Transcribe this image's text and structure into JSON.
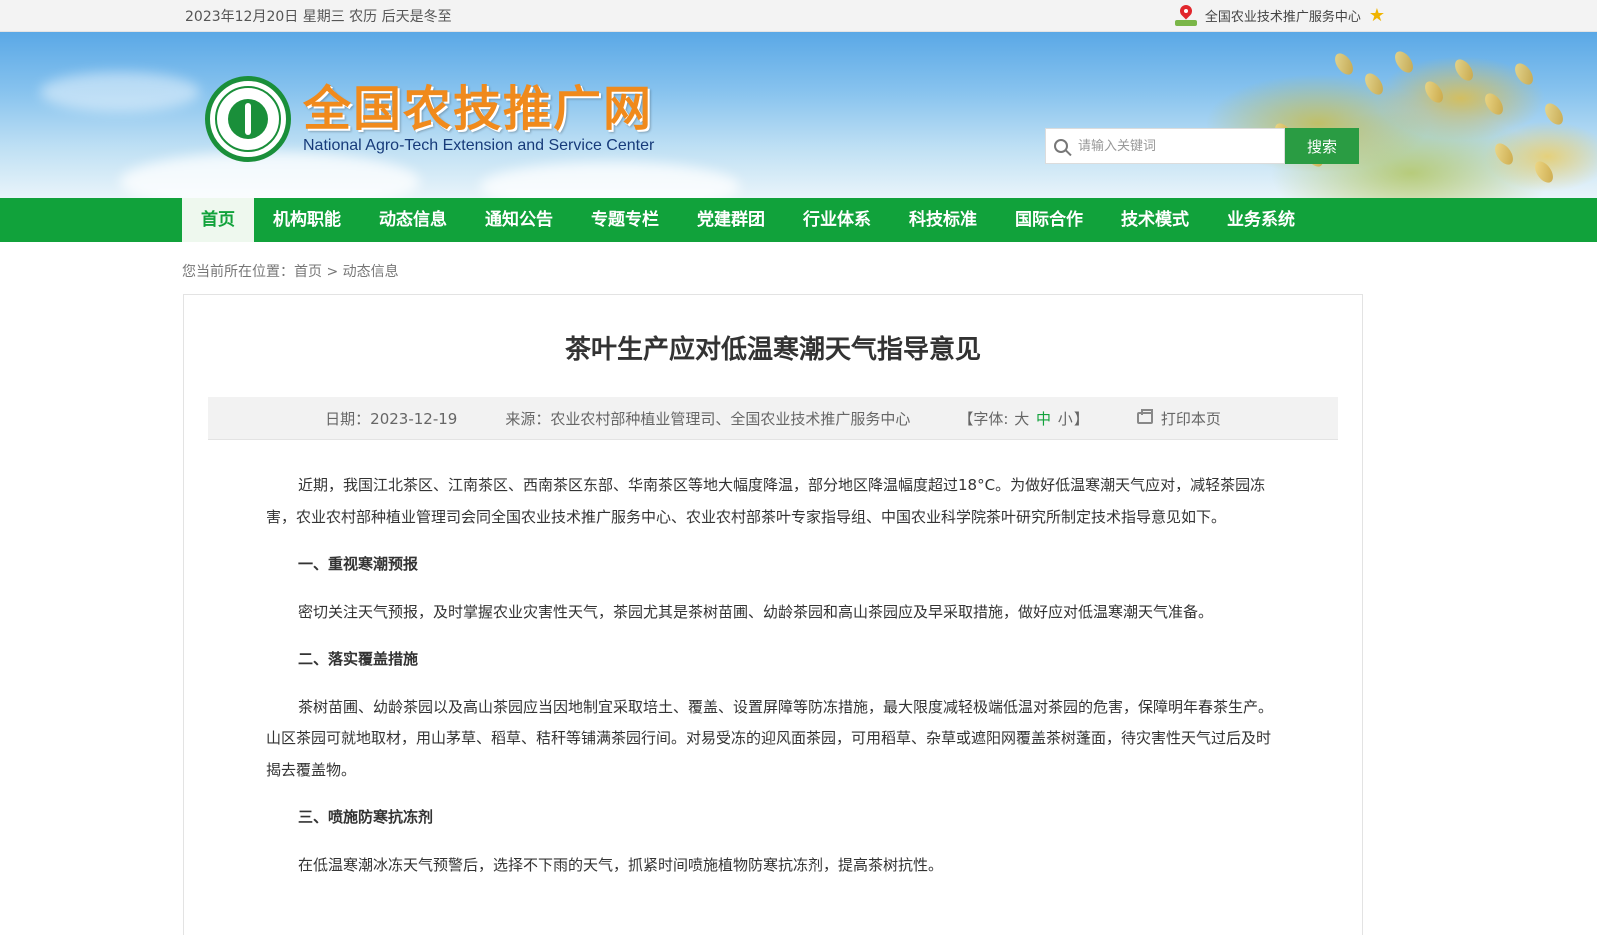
{
  "topbar": {
    "date": "2023年12月20日 星期三 农历 后天是冬至",
    "site_name": "全国农业技术推广服务中心"
  },
  "banner": {
    "brand_cn": "全国农技推广网",
    "brand_en": "National Agro-Tech Extension and Service Center"
  },
  "search": {
    "placeholder": "请输入关键词",
    "button": "搜索"
  },
  "nav": [
    {
      "label": "首页"
    },
    {
      "label": "机构职能"
    },
    {
      "label": "动态信息"
    },
    {
      "label": "通知公告"
    },
    {
      "label": "专题专栏"
    },
    {
      "label": "党建群团"
    },
    {
      "label": "行业体系"
    },
    {
      "label": "科技标准"
    },
    {
      "label": "国际合作"
    },
    {
      "label": "技术模式"
    },
    {
      "label": "业务系统"
    }
  ],
  "breadcrumb": {
    "prefix": "您当前所在位置：",
    "home": "首页",
    "sep": ">",
    "current": "动态信息"
  },
  "article": {
    "title": "茶叶生产应对低温寒潮天气指导意见",
    "date": "日期：2023-12-19",
    "source": "来源：农业农村部种植业管理司、全国农业技术推广服务中心",
    "font_prefix": "【字体:",
    "font_large": "大",
    "font_medium": "中",
    "font_small": "小",
    "font_suffix": "】",
    "print": "打印本页",
    "paragraphs": [
      "近期，我国江北茶区、江南茶区、西南茶区东部、华南茶区等地大幅度降温，部分地区降温幅度超过18°C。为做好低温寒潮天气应对，减轻茶园冻害，农业农村部种植业管理司会同全国农业技术推广服务中心、农业农村部茶叶专家指导组、中国农业科学院茶叶研究所制定技术指导意见如下。",
      "一、重视寒潮预报",
      "密切关注天气预报，及时掌握农业灾害性天气，茶园尤其是茶树苗圃、幼龄茶园和高山茶园应及早采取措施，做好应对低温寒潮天气准备。",
      "二、落实覆盖措施",
      "茶树苗圃、幼龄茶园以及高山茶园应当因地制宜采取培土、覆盖、设置屏障等防冻措施，最大限度减轻极端低温对茶园的危害，保障明年春茶生产。山区茶园可就地取材，用山茅草、稻草、秸秆等铺满茶园行间。对易受冻的迎风面茶园，可用稻草、杂草或遮阳网覆盖茶树蓬面，待灾害性天气过后及时揭去覆盖物。",
      "三、喷施防寒抗冻剂",
      "在低温寒潮冰冻天气预警后，选择不下雨的天气，抓紧时间喷施植物防寒抗冻剂，提高茶树抗性。"
    ]
  },
  "colors": {
    "nav_green": "#11a23b",
    "brand_orange": "#f08a1c",
    "search_button": "#2a9c43"
  }
}
